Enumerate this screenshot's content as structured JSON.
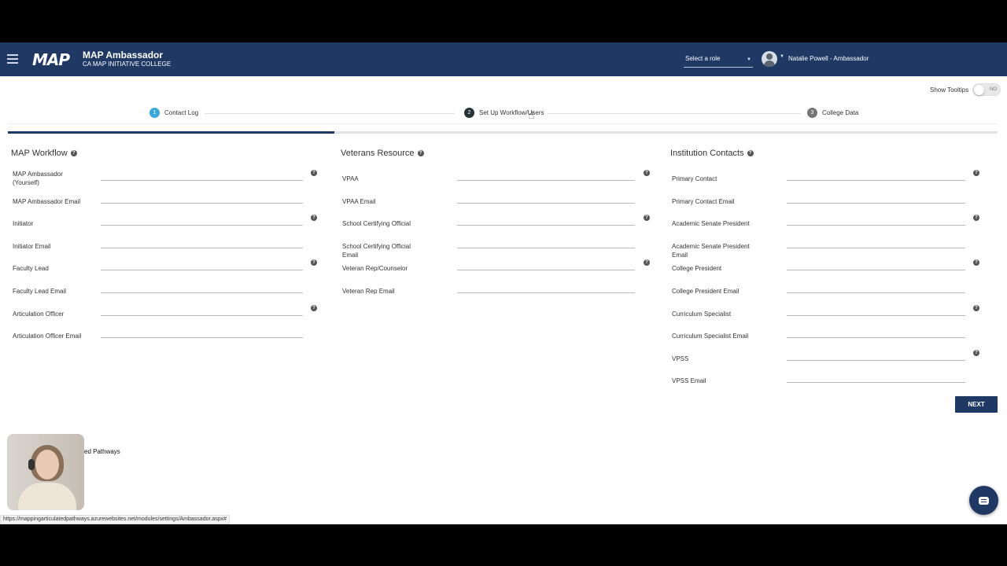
{
  "header": {
    "logo_text": "MAP",
    "app_title": "MAP Ambassador",
    "app_subtitle": "CA MAP INITIATIVE COLLEGE",
    "role_select_value": "Select a role",
    "user_name": "Natalie Powell - Ambassador",
    "bg_color": "#1f3864"
  },
  "tooltips": {
    "label": "Show Tooltips",
    "state": "NO"
  },
  "stepper": {
    "steps": [
      {
        "num": "1",
        "label": "Contact Log"
      },
      {
        "num": "2",
        "label": "Set Up Workflow/Users"
      },
      {
        "num": "3",
        "label": "College Data"
      }
    ],
    "progress_fraction": 0.33
  },
  "help_glyph": "?",
  "sections": {
    "workflow": {
      "title": "MAP Workflow",
      "fields": [
        "MAP Ambassador (Yourself)",
        "MAP Ambassador Email",
        "Initiator",
        "Initiator Email",
        "Faculty Lead",
        "Faculty Lead Email",
        "Articulation Officer",
        "Articulation Officer Email"
      ]
    },
    "veterans": {
      "title": "Veterans Resource",
      "fields": [
        "VPAA",
        "VPAA Email",
        "School Certifying Official",
        "School Certifying Official Email",
        "Veteran Rep/Counselor",
        "Veteran Rep Email"
      ]
    },
    "institution": {
      "title": "Institution Contacts",
      "fields": [
        "Primary Contact",
        "Primary Contact Email",
        "Academic Senate President",
        "Academic Senate President Email",
        "College President",
        "College President Email",
        "Curriculum Specialist",
        "Curriculum Specialist Email",
        "VPSS",
        "VPSS Email"
      ]
    }
  },
  "next_button": "NEXT",
  "footer_fragment": "ed Pathways",
  "status_url": "https://mappingarticulatedpathways.azurewebsites.net/modules/settings/Ambassador.aspx#"
}
